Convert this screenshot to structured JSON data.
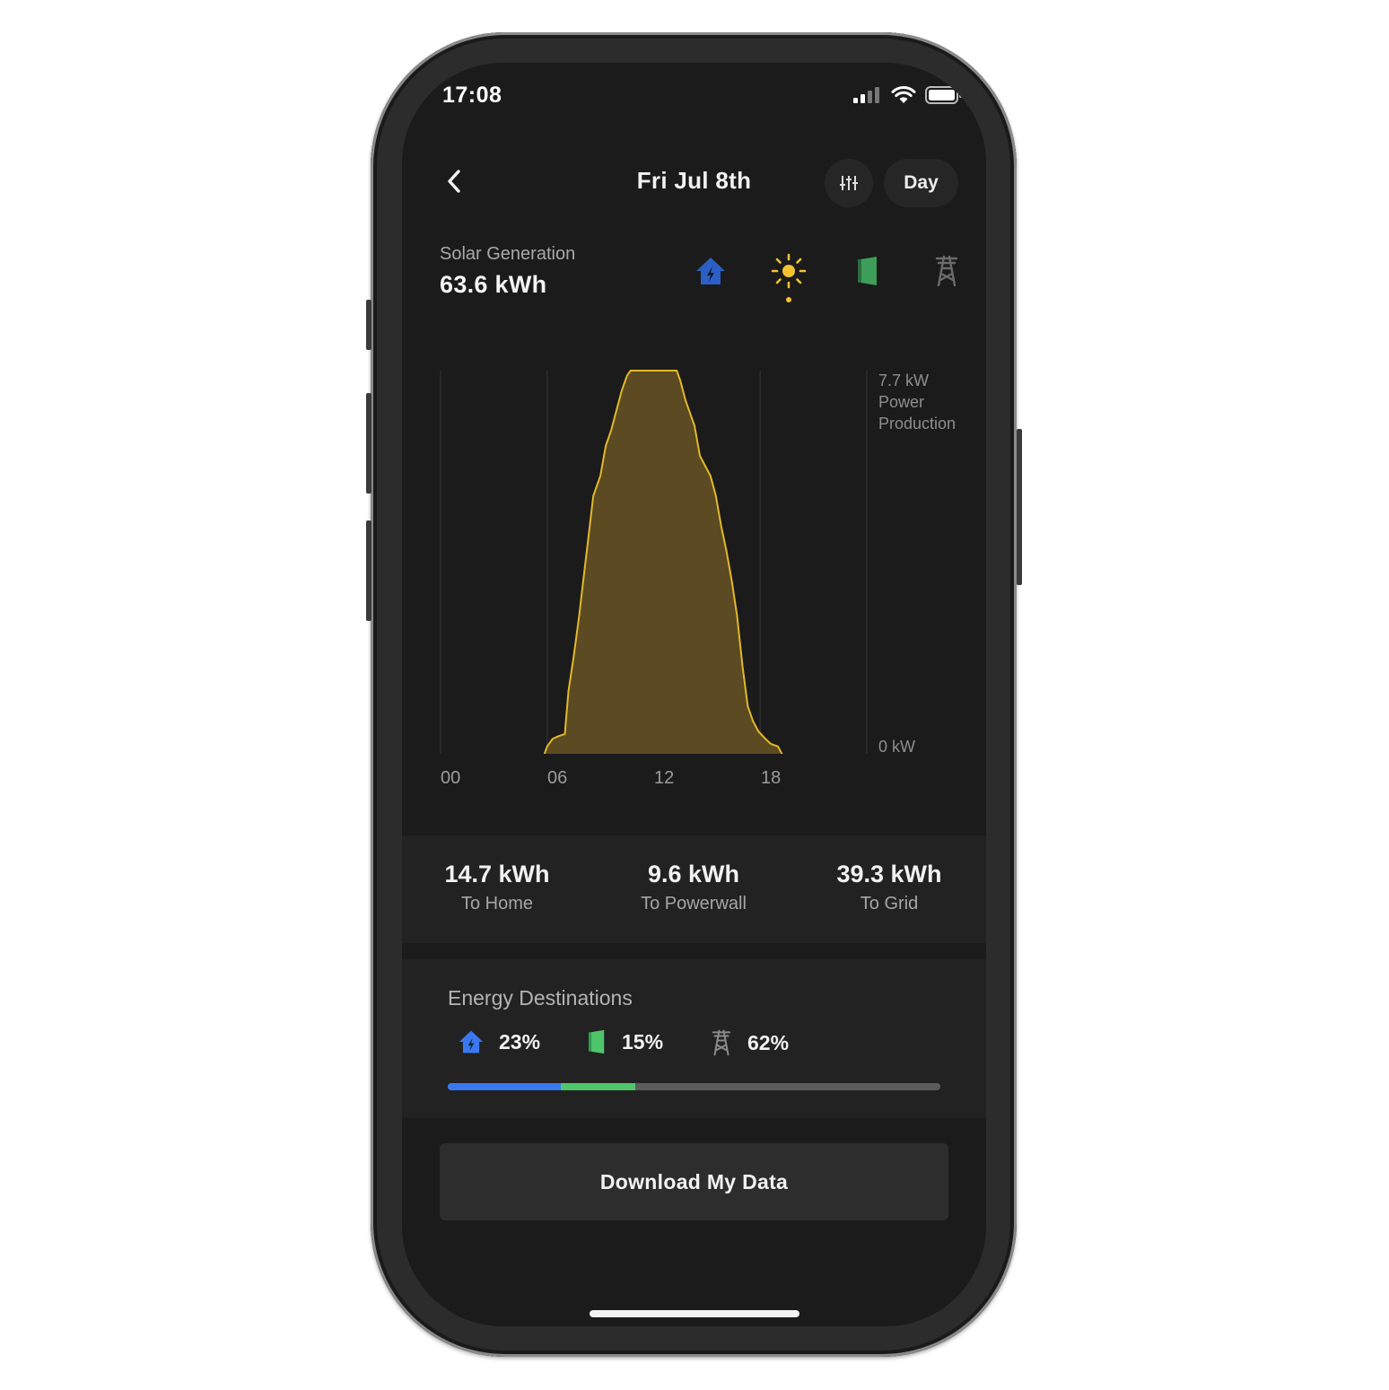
{
  "status_bar": {
    "time": "17:08",
    "icons": [
      "cellular-signal-icon",
      "wifi-icon",
      "battery-icon"
    ]
  },
  "header": {
    "title": "Fri Jul 8th",
    "period_label": "Day"
  },
  "summary": {
    "label": "Solar Generation",
    "value": "63.6 kWh"
  },
  "source_icons": [
    {
      "name": "home-icon",
      "color": "#2c5fc4"
    },
    {
      "name": "sun-icon",
      "color": "#f2c230",
      "selected": true
    },
    {
      "name": "powerwall-icon",
      "color": "#3d9e5a"
    },
    {
      "name": "grid-tower-icon",
      "color": "#6b6b6b"
    }
  ],
  "chart": {
    "max_label": "7.7 kW",
    "axis_title_1": "Power",
    "axis_title_2": "Production",
    "min_label": "0 kW",
    "x_ticks": [
      "00",
      "06",
      "12",
      "18"
    ]
  },
  "chart_data": {
    "type": "area",
    "title": "",
    "xlabel": "",
    "ylabel": "Power Production",
    "xlim": [
      0,
      24
    ],
    "ylim": [
      0,
      7.7
    ],
    "x_ticks": [
      "00",
      "06",
      "12",
      "18"
    ],
    "color": "#e2b92a",
    "fill": "#5b4a22",
    "x": [
      0,
      5.8,
      6.0,
      6.3,
      6.6,
      7.0,
      7.2,
      7.5,
      7.8,
      8.0,
      8.3,
      8.6,
      9.0,
      9.3,
      9.6,
      9.9,
      10.2,
      10.5,
      10.7,
      11.0,
      11.5,
      12.0,
      12.5,
      13.0,
      13.3,
      13.5,
      13.8,
      14.0,
      14.3,
      14.6,
      14.9,
      15.2,
      15.5,
      15.8,
      16.1,
      16.4,
      16.7,
      17.0,
      17.3,
      17.6,
      17.9,
      18.3,
      18.6,
      19.0,
      19.3,
      20.0,
      24
    ],
    "y": [
      0,
      0,
      0.2,
      0.35,
      0.4,
      0.45,
      1.3,
      2.0,
      2.8,
      3.4,
      4.3,
      5.2,
      5.6,
      6.2,
      6.5,
      6.9,
      7.3,
      7.6,
      7.7,
      7.7,
      7.7,
      7.7,
      7.7,
      7.7,
      7.7,
      7.5,
      7.1,
      6.9,
      6.6,
      6.0,
      5.8,
      5.6,
      5.2,
      4.6,
      4.1,
      3.5,
      2.8,
      1.8,
      1.0,
      0.7,
      0.5,
      0.35,
      0.25,
      0.2,
      0.0,
      0.0,
      0.0
    ]
  },
  "stats": [
    {
      "value": "14.7 kWh",
      "label": "To Home"
    },
    {
      "value": "9.6 kWh",
      "label": "To Powerwall"
    },
    {
      "value": "39.3 kWh",
      "label": "To Grid"
    }
  ],
  "destinations": {
    "title": "Energy Destinations",
    "items": [
      {
        "icon": "home-icon",
        "percent_label": "23%",
        "percent": 23,
        "color": "#3a78ef"
      },
      {
        "icon": "powerwall-icon",
        "percent_label": "15%",
        "percent": 15,
        "color": "#4fc66b"
      },
      {
        "icon": "grid-tower-icon",
        "percent_label": "62%",
        "percent": 62,
        "color": "#5c5c5c"
      }
    ]
  },
  "download_label": "Download My Data"
}
